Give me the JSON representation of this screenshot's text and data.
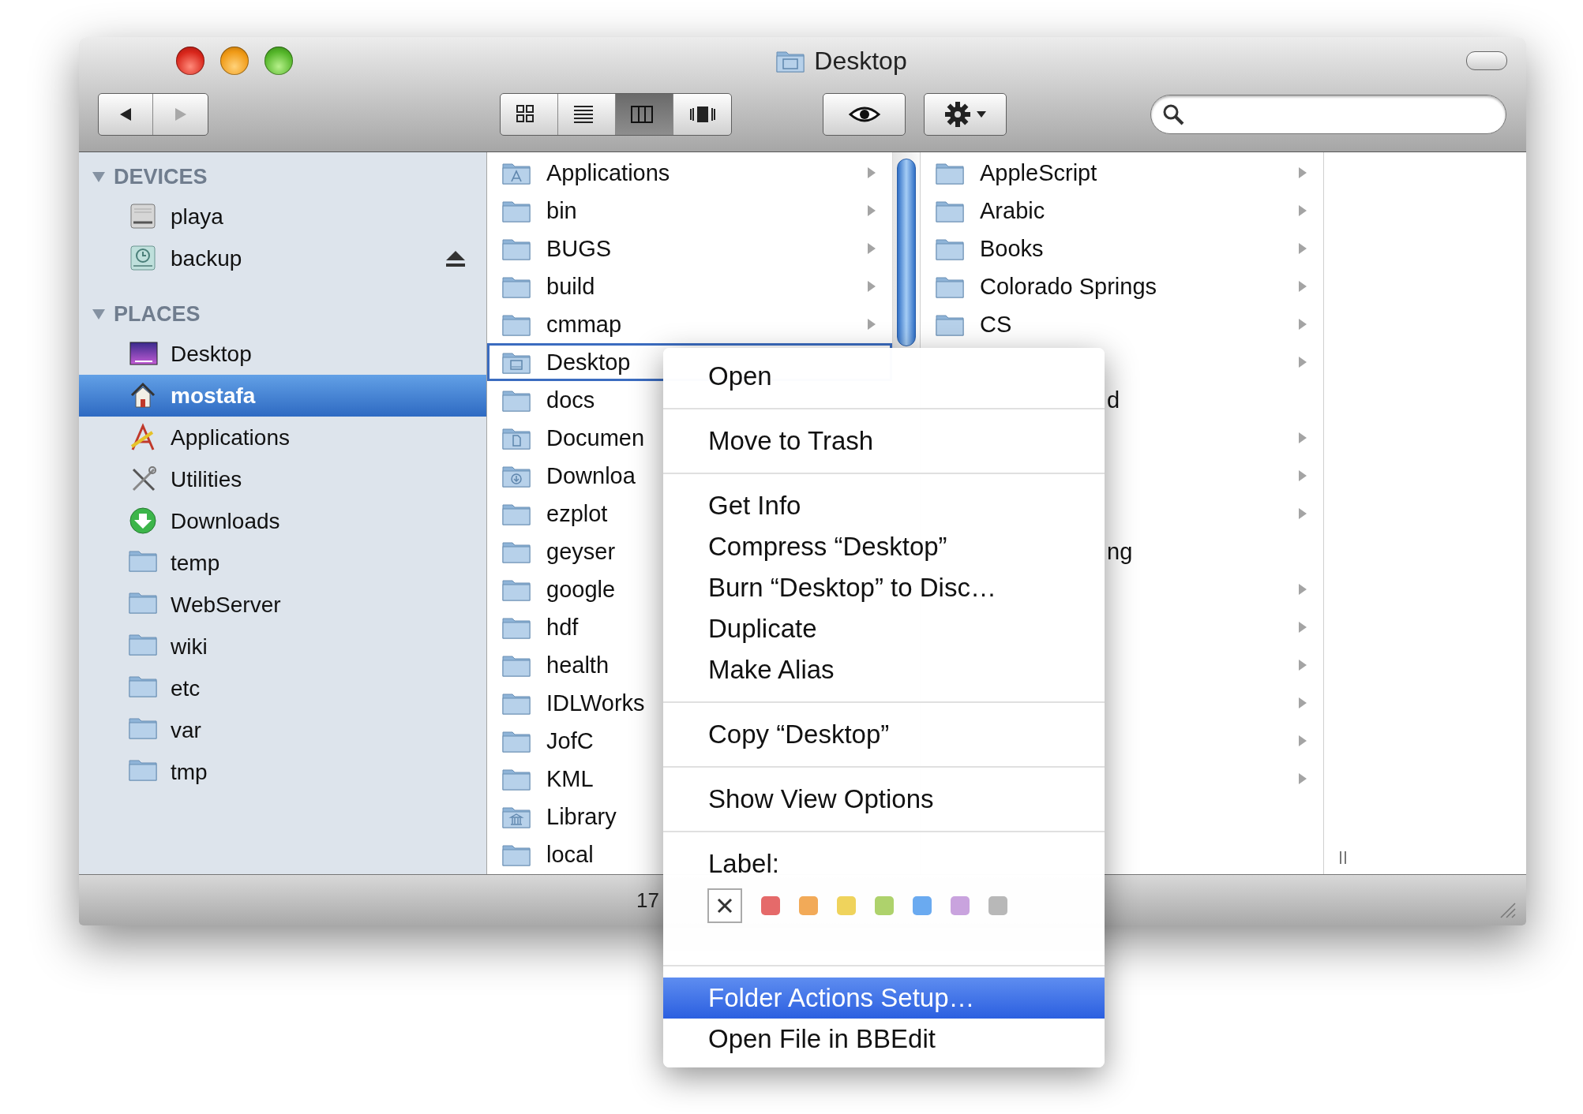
{
  "window": {
    "title": "Desktop"
  },
  "toolbar": {
    "navigation": [
      {
        "kind": "back",
        "disabled": false
      },
      {
        "kind": "forward",
        "disabled": true
      }
    ],
    "views": [
      {
        "kind": "icon",
        "selected": false
      },
      {
        "kind": "list",
        "selected": false
      },
      {
        "kind": "column",
        "selected": true
      },
      {
        "kind": "coverflow",
        "selected": false
      }
    ],
    "actions": [
      {
        "kind": "quicklook"
      },
      {
        "kind": "action"
      }
    ]
  },
  "sidebar": {
    "sections": [
      {
        "title": "DEVICES",
        "expanded": true,
        "items": [
          {
            "label": "playa",
            "kind": "drive",
            "selected": false,
            "ejectable": false
          },
          {
            "label": "backup",
            "kind": "backup",
            "selected": false,
            "ejectable": true
          }
        ]
      },
      {
        "title": "PLACES",
        "expanded": true,
        "items": [
          {
            "label": "Desktop",
            "kind": "desktop",
            "selected": false,
            "ejectable": false
          },
          {
            "label": "mostafa",
            "kind": "home",
            "selected": true,
            "ejectable": false
          },
          {
            "label": "Applications",
            "kind": "applications",
            "selected": false,
            "ejectable": false
          },
          {
            "label": "Utilities",
            "kind": "utilities",
            "selected": false,
            "ejectable": false
          },
          {
            "label": "Downloads",
            "kind": "downloads",
            "selected": false,
            "ejectable": false
          },
          {
            "label": "temp",
            "kind": "folder",
            "selected": false,
            "ejectable": false
          },
          {
            "label": "WebServer",
            "kind": "folder",
            "selected": false,
            "ejectable": false
          },
          {
            "label": "wiki",
            "kind": "folder",
            "selected": false,
            "ejectable": false
          },
          {
            "label": "etc",
            "kind": "folder",
            "selected": false,
            "ejectable": false
          },
          {
            "label": "var",
            "kind": "folder",
            "selected": false,
            "ejectable": false
          },
          {
            "label": "tmp",
            "kind": "folder",
            "selected": false,
            "ejectable": false
          }
        ]
      }
    ]
  },
  "columns": [
    {
      "rows": [
        {
          "name": "Applications",
          "kind": "applications",
          "has_arrow": true,
          "selected": false
        },
        {
          "name": "bin",
          "kind": "folder",
          "has_arrow": true,
          "selected": false
        },
        {
          "name": "BUGS",
          "kind": "folder",
          "has_arrow": true,
          "selected": false
        },
        {
          "name": "build",
          "kind": "folder",
          "has_arrow": true,
          "selected": false
        },
        {
          "name": "cmmap",
          "kind": "folder",
          "has_arrow": true,
          "selected": false
        },
        {
          "name": "Desktop",
          "kind": "desktop",
          "has_arrow": false,
          "selected": true
        },
        {
          "name": "docs",
          "kind": "folder",
          "has_arrow": false,
          "selected": false
        },
        {
          "name": "Documen",
          "kind": "documents",
          "has_arrow": false,
          "selected": false
        },
        {
          "name": "Downloa",
          "kind": "downloads",
          "has_arrow": false,
          "selected": false
        },
        {
          "name": "ezplot",
          "kind": "folder",
          "has_arrow": false,
          "selected": false
        },
        {
          "name": "geyser",
          "kind": "folder",
          "has_arrow": false,
          "selected": false
        },
        {
          "name": "google",
          "kind": "folder",
          "has_arrow": false,
          "selected": false
        },
        {
          "name": "hdf",
          "kind": "folder",
          "has_arrow": false,
          "selected": false
        },
        {
          "name": "health",
          "kind": "folder",
          "has_arrow": false,
          "selected": false
        },
        {
          "name": "IDLWorks",
          "kind": "folder",
          "has_arrow": false,
          "selected": false
        },
        {
          "name": "JofC",
          "kind": "folder",
          "has_arrow": false,
          "selected": false
        },
        {
          "name": "KML",
          "kind": "folder",
          "has_arrow": false,
          "selected": false
        },
        {
          "name": "Library",
          "kind": "library",
          "has_arrow": false,
          "selected": false
        },
        {
          "name": "local",
          "kind": "folder",
          "has_arrow": false,
          "selected": false
        }
      ]
    },
    {
      "rows": [
        {
          "name": "AppleScript",
          "kind": "folder",
          "has_arrow": true,
          "selected": false
        },
        {
          "name": "Arabic",
          "kind": "folder",
          "has_arrow": true,
          "selected": false
        },
        {
          "name": "Books",
          "kind": "folder",
          "has_arrow": true,
          "selected": false
        },
        {
          "name": "Colorado Springs",
          "kind": "folder",
          "has_arrow": true,
          "selected": false
        },
        {
          "name": "CS",
          "kind": "folder",
          "has_arrow": true,
          "selected": false
        },
        {
          "kind": "covered",
          "has_arrow": true,
          "selected": false
        },
        {
          "name": "d",
          "kind": "covered",
          "has_arrow": false,
          "selected": false
        },
        {
          "kind": "covered",
          "has_arrow": true,
          "selected": false
        },
        {
          "kind": "covered",
          "has_arrow": true,
          "selected": false
        },
        {
          "kind": "covered",
          "has_arrow": true,
          "selected": false
        },
        {
          "name": "ng",
          "kind": "covered",
          "has_arrow": false,
          "selected": false
        },
        {
          "kind": "covered",
          "has_arrow": true,
          "selected": false
        },
        {
          "kind": "covered",
          "has_arrow": true,
          "selected": false
        },
        {
          "kind": "covered",
          "has_arrow": true,
          "selected": false
        },
        {
          "kind": "covered",
          "has_arrow": true,
          "selected": false
        },
        {
          "kind": "covered",
          "has_arrow": true,
          "selected": false
        },
        {
          "kind": "covered",
          "has_arrow": true,
          "selected": false
        }
      ]
    }
  ],
  "status_bar": {
    "text": "17"
  },
  "context_menu": {
    "items": [
      {
        "kind": "command",
        "label": "Open",
        "selected": false
      },
      {
        "kind": "separator"
      },
      {
        "kind": "command",
        "label": "Move to Trash",
        "selected": false
      },
      {
        "kind": "separator"
      },
      {
        "kind": "command",
        "label": "Get Info",
        "selected": false
      },
      {
        "kind": "command",
        "label": "Compress “Desktop”",
        "selected": false
      },
      {
        "kind": "command",
        "label": "Burn “Desktop” to Disc…",
        "selected": false
      },
      {
        "kind": "command",
        "label": "Duplicate",
        "selected": false
      },
      {
        "kind": "command",
        "label": "Make Alias",
        "selected": false
      },
      {
        "kind": "separator"
      },
      {
        "kind": "command",
        "label": "Copy “Desktop”",
        "selected": false
      },
      {
        "kind": "separator"
      },
      {
        "kind": "command",
        "label": "Show View Options",
        "selected": false
      },
      {
        "kind": "separator"
      },
      {
        "kind": "label_picker",
        "title": "Label:",
        "swatches": [
          {
            "kind": "none"
          },
          {
            "kind": "color",
            "color": "#e56a6a"
          },
          {
            "kind": "color",
            "color": "#f2aa58"
          },
          {
            "kind": "color",
            "color": "#efd35c"
          },
          {
            "kind": "color",
            "color": "#aed26c"
          },
          {
            "kind": "color",
            "color": "#6aaaf0"
          },
          {
            "kind": "color",
            "color": "#c9a3de"
          },
          {
            "kind": "color",
            "color": "#b8b8b8"
          }
        ]
      },
      {
        "kind": "separator"
      },
      {
        "kind": "command",
        "label": "Folder Actions Setup…",
        "selected": true
      },
      {
        "kind": "command",
        "label": "Open File in BBEdit",
        "selected": false
      }
    ]
  }
}
